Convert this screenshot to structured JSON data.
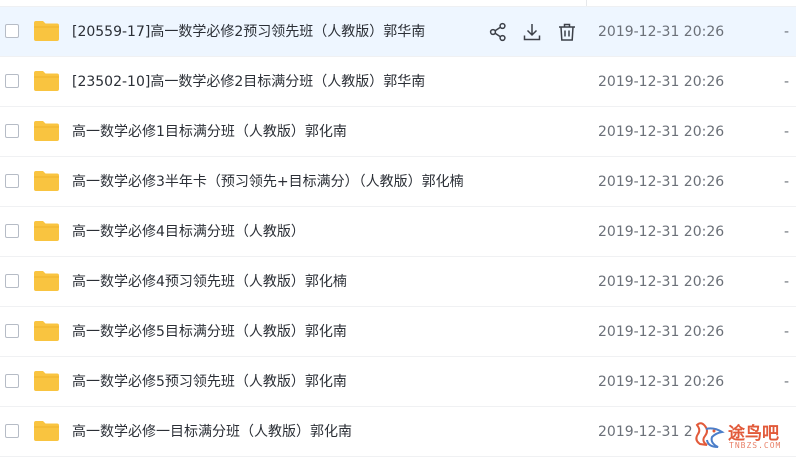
{
  "files": [
    {
      "name": "[20559-17]高一数学必修2预习领先班（人教版）郭华南",
      "date": "2019-12-31 20:26",
      "size": "-"
    },
    {
      "name": "[23502-10]高一数学必修2目标满分班（人教版）郭华南",
      "date": "2019-12-31 20:26",
      "size": "-"
    },
    {
      "name": "高一数学必修1目标满分班（人教版）郭化南",
      "date": "2019-12-31 20:26",
      "size": "-"
    },
    {
      "name": "高一数学必修3半年卡（预习领先+目标满分）（人教版）郭化楠",
      "date": "2019-12-31 20:26",
      "size": "-"
    },
    {
      "name": "高一数学必修4目标满分班（人教版）",
      "date": "2019-12-31 20:26",
      "size": "-"
    },
    {
      "name": "高一数学必修4预习领先班（人教版）郭化楠",
      "date": "2019-12-31 20:26",
      "size": "-"
    },
    {
      "name": "高一数学必修5目标满分班（人教版）郭化南",
      "date": "2019-12-31 20:26",
      "size": "-"
    },
    {
      "name": "高一数学必修5预习领先班（人教版）郭化南",
      "date": "2019-12-31 20:26",
      "size": "-"
    },
    {
      "name": "高一数学必修一目标满分班（人教版）郭化南",
      "date": "2019-12-31 2",
      "size": "-"
    }
  ],
  "hover_actions": {
    "icons": [
      "share-icon",
      "download-icon",
      "delete-icon"
    ]
  },
  "watermark": {
    "text": "途鸟吧",
    "sub": "TNBZS.COM"
  },
  "colors": {
    "folder": "#f9c440",
    "hover_row": "#eef6ff",
    "action_icon": "#3c4048",
    "watermark": "#e25a3a"
  }
}
